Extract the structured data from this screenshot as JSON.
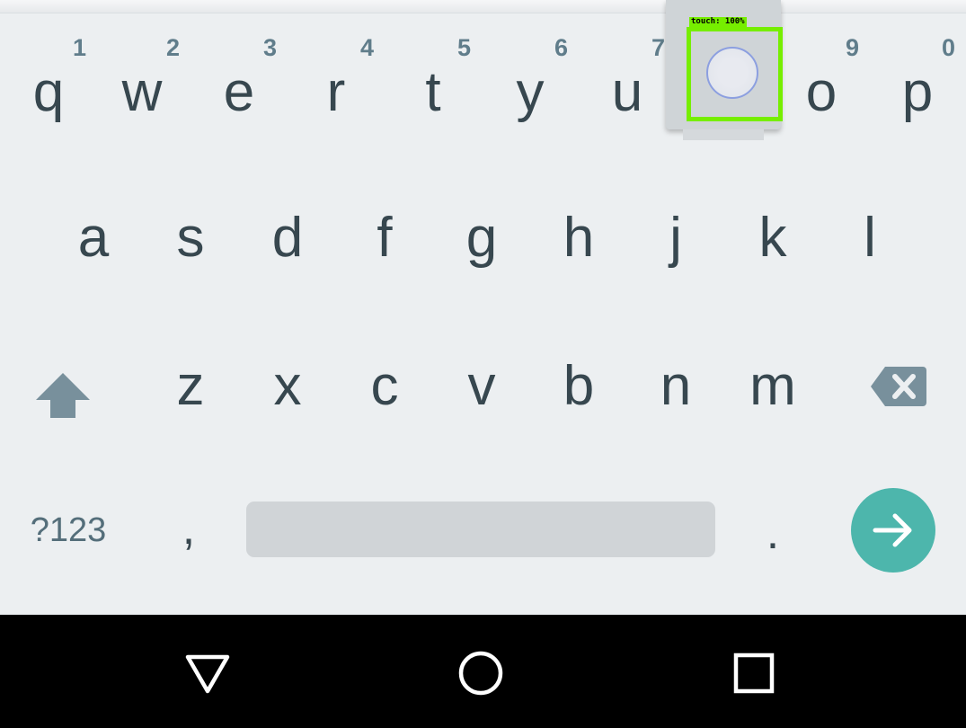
{
  "keyboard": {
    "row1": [
      {
        "letter": "q",
        "hint": "1"
      },
      {
        "letter": "w",
        "hint": "2"
      },
      {
        "letter": "e",
        "hint": "3"
      },
      {
        "letter": "r",
        "hint": "4"
      },
      {
        "letter": "t",
        "hint": "5"
      },
      {
        "letter": "y",
        "hint": "6"
      },
      {
        "letter": "u",
        "hint": "7"
      },
      {
        "letter": "",
        "hint": ""
      },
      {
        "letter": "o",
        "hint": "9"
      },
      {
        "letter": "p",
        "hint": "0"
      }
    ],
    "row2": [
      "a",
      "s",
      "d",
      "f",
      "g",
      "h",
      "j",
      "k",
      "l"
    ],
    "row3": [
      "z",
      "x",
      "c",
      "v",
      "b",
      "n",
      "m"
    ],
    "symbols_label": "?123",
    "comma_label": ",",
    "period_label": "."
  },
  "touch_overlay": {
    "label": "touch: 100%",
    "color": "#76ee00"
  },
  "colors": {
    "keyboard_bg": "#eceff1",
    "key_text": "#37474f",
    "hint_text": "#607d8b",
    "enter_accent": "#4db6ac",
    "navbar_bg": "#000000"
  },
  "icons": {
    "shift": "shift-arrow-icon",
    "backspace": "backspace-icon",
    "enter": "arrow-right-icon",
    "nav_back": "back-triangle-icon",
    "nav_home": "home-circle-icon",
    "nav_recents": "recents-square-icon"
  }
}
